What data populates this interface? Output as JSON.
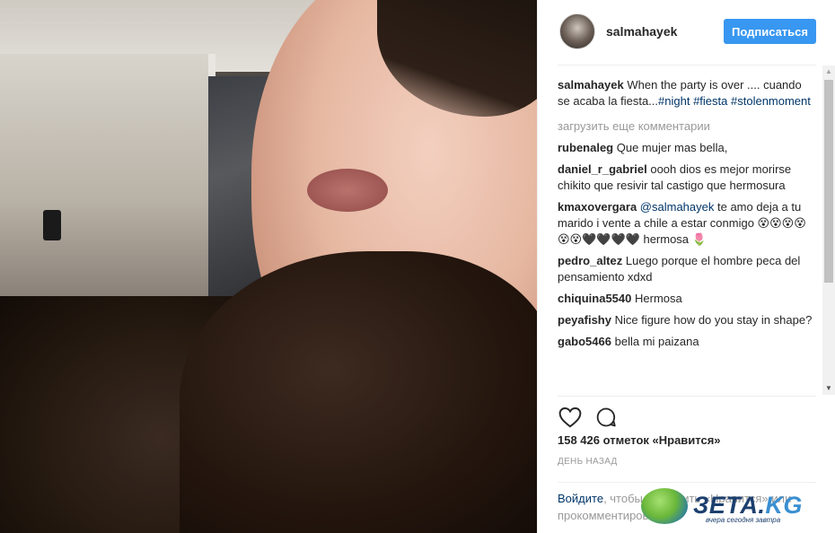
{
  "header": {
    "username": "salmahayek",
    "follow_label": "Подписаться"
  },
  "caption": {
    "user": "salmahayek",
    "text": "When the party is over .... cuando se acaba la fiesta...",
    "hashtags": [
      "#night",
      "#fiesta",
      "#stolenmoment"
    ]
  },
  "load_more": "загрузить еще комментарии",
  "comments": [
    {
      "user": "rubenaleg",
      "text": "Que mujer mas bella,"
    },
    {
      "user": "daniel_r_gabriel",
      "text": "oooh dios es mejor morirse chikito que resivir tal castigo que hermosura"
    },
    {
      "user": "kmaxovergara",
      "mention": "@salmahayek",
      "text": "te amo deja a tu marido i vente a chile a estar conmigo 😵😵😵😵😵😵🖤🖤🖤🖤 hermosa 🌷"
    },
    {
      "user": "pedro_altez",
      "text": "Luego porque el hombre peca del pensamiento xdxd"
    },
    {
      "user": "chiquina5540",
      "text": "Hermosa"
    },
    {
      "user": "peyafishy",
      "text": "Nice figure how do you stay in shape?"
    },
    {
      "user": "gabo5466",
      "text": "bella mi paizana"
    }
  ],
  "likes": "158 426 отметок «Нравится»",
  "date": "ДЕНЬ НАЗАД",
  "login": {
    "link": "Войдите",
    "text": ", чтобы поставить «Нравится» или прокомментировать."
  },
  "watermark": {
    "brand": "ЗЕТА.",
    "tld": "KG",
    "tagline": "вчера сегодня завтра"
  },
  "icons": {
    "like": "heart-outline-icon",
    "comment": "speech-bubble-icon"
  }
}
